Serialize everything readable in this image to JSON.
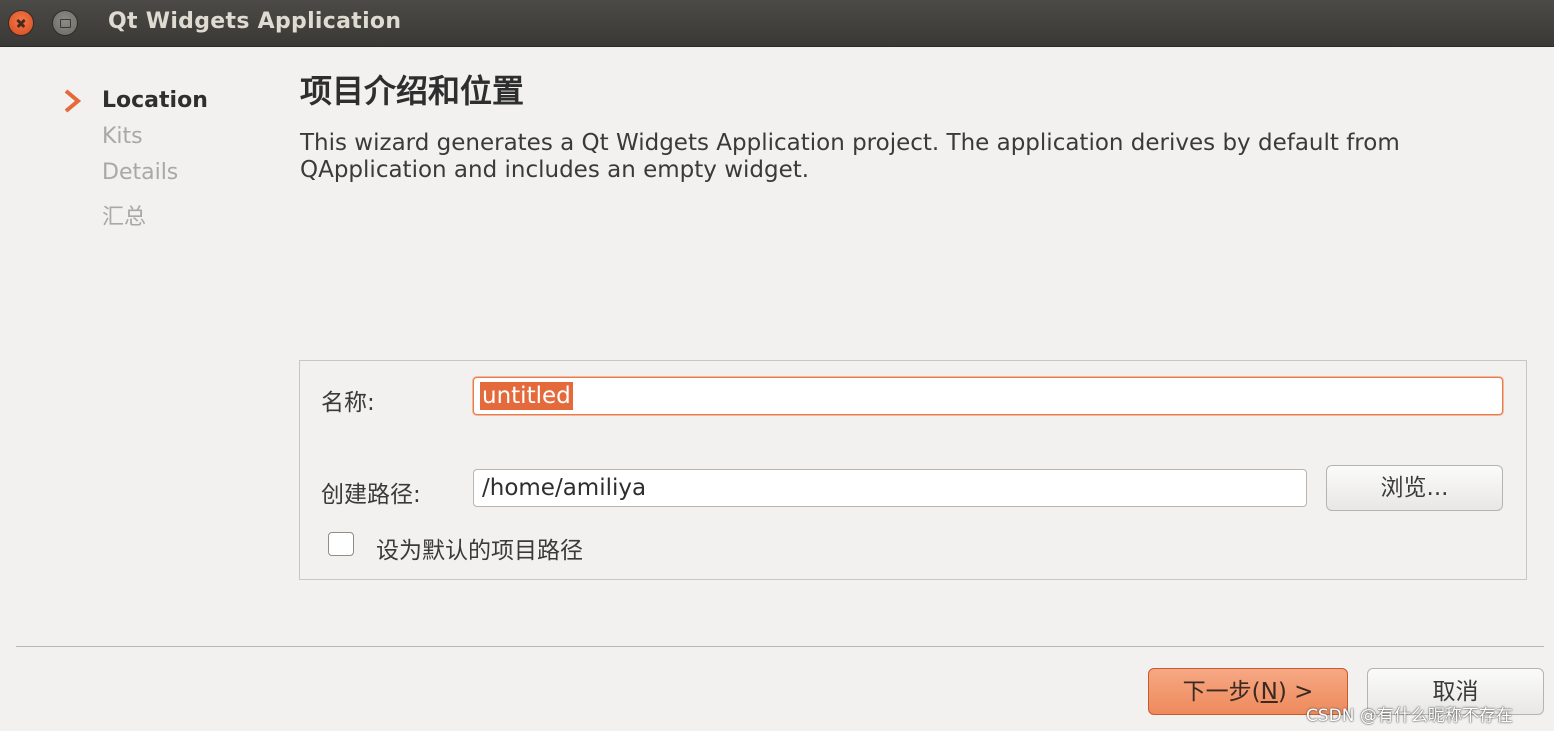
{
  "window": {
    "title": "Qt Widgets Application"
  },
  "steps": {
    "items": [
      {
        "label": "Location",
        "active": true
      },
      {
        "label": "Kits",
        "active": false
      },
      {
        "label": "Details",
        "active": false
      },
      {
        "label": "汇总",
        "active": false
      }
    ]
  },
  "main": {
    "title": "项目介绍和位置",
    "intro": "This wizard generates a Qt Widgets Application project. The application derives by default from QApplication and includes an empty widget."
  },
  "form": {
    "name_label": "名称:",
    "name_value": "untitled",
    "path_label": "创建路径:",
    "path_value": "/home/amiliya",
    "browse_label": "浏览...",
    "default_checkbox_label": "设为默认的项目路径",
    "default_checked": false
  },
  "footer": {
    "next_label_prefix": "下一步(",
    "next_mnemonic": "N",
    "next_label_suffix": ") >",
    "cancel_label": "取消"
  },
  "watermark": "CSDN @有什么昵称不存在",
  "colors": {
    "accent": "#e46a3c",
    "titlebar": "#3f3e3a",
    "background": "#f2f1f0"
  }
}
